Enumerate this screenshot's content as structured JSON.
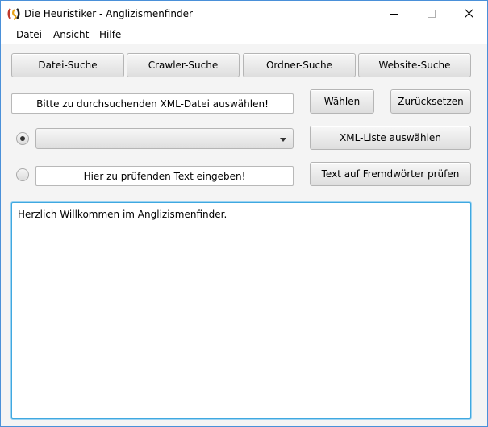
{
  "window": {
    "title": "Die Heuristiker - Anglizismenfinder"
  },
  "menubar": {
    "items": [
      "Datei",
      "Ansicht",
      "Hilfe"
    ]
  },
  "tabs": {
    "file_search": "Datei-Suche",
    "crawler_search": "Crawler-Suche",
    "folder_search": "Ordner-Suche",
    "website_search": "Website-Suche"
  },
  "file_row": {
    "path_field_value": "Bitte zu durchsuchenden XML-Datei auswählen!",
    "choose_button": "Wählen",
    "reset_button": "Zurücksetzen"
  },
  "xml_row": {
    "radio_selected": true,
    "combo_value": "",
    "xml_list_button": "XML-Liste auswählen"
  },
  "text_row": {
    "radio_selected": false,
    "text_field_value": "Hier zu prüfenden Text eingeben!",
    "check_button": "Text auf Fremdwörter prüfen"
  },
  "output": {
    "text": "Herzlich Willkommen im Anglizismenfinder."
  },
  "colors": {
    "accent_border": "#3fa8e0",
    "window_border": "#4a90d9"
  }
}
